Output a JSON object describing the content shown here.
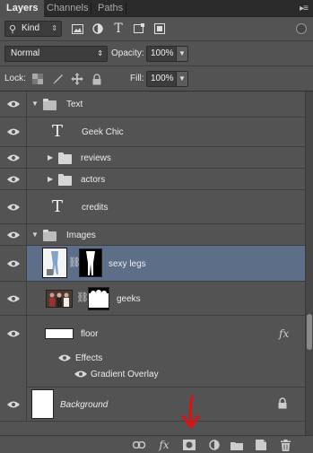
{
  "tabs": [
    {
      "label": "Layers",
      "active": true
    },
    {
      "label": "Channels",
      "active": false
    },
    {
      "label": "Paths",
      "active": false
    }
  ],
  "filter": {
    "kind_label": "Kind",
    "icons": [
      "image-filter-icon",
      "adjustment-filter-icon",
      "type-filter-icon",
      "shape-filter-icon",
      "smart-object-filter-icon"
    ]
  },
  "blend": {
    "mode": "Normal",
    "opacity_label": "Opacity:",
    "opacity_value": "100%"
  },
  "lock": {
    "label": "Lock:",
    "fill_label": "Fill:",
    "fill_value": "100%"
  },
  "layers": [
    {
      "name": "Text",
      "type": "group-open"
    },
    {
      "name": "Geek Chic",
      "type": "text"
    },
    {
      "name": "reviews",
      "type": "group-closed"
    },
    {
      "name": "actors",
      "type": "group-closed"
    },
    {
      "name": "credits",
      "type": "text"
    },
    {
      "name": "Images",
      "type": "group-open"
    },
    {
      "name": "sexy legs",
      "type": "masked-image",
      "selected": true
    },
    {
      "name": "geeks",
      "type": "masked-image"
    },
    {
      "name": "floor",
      "type": "fill",
      "fx": "fx"
    },
    {
      "name": "Background",
      "type": "background"
    }
  ],
  "effects": {
    "label": "Effects",
    "items": [
      "Gradient Overlay"
    ]
  },
  "bottom_icons": [
    "link-layers-icon",
    "fx-icon",
    "add-mask-icon",
    "adjustment-layer-icon",
    "new-group-icon",
    "new-layer-icon",
    "trash-icon"
  ],
  "fx_label": "fx",
  "colors": {
    "panel": "#535353",
    "selected": "#5d6e88",
    "annotation_arrow": "#e01010"
  }
}
